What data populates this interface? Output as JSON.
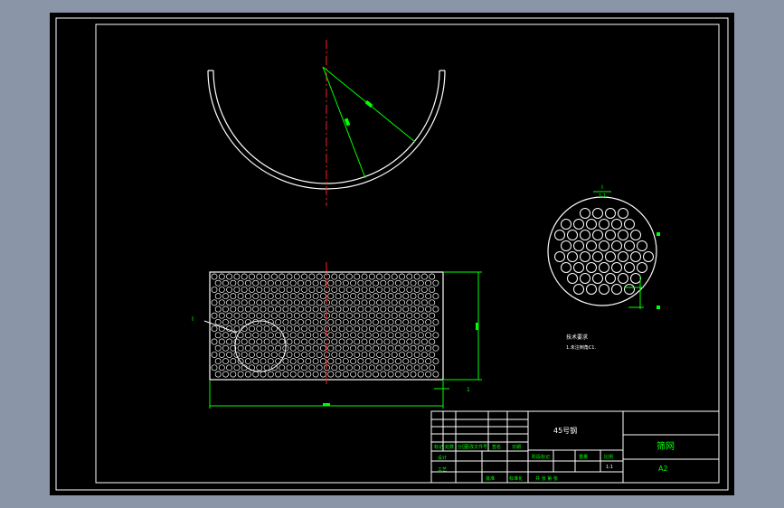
{
  "colors": {
    "app_background": "#8b95a8",
    "drawing_background": "#000000",
    "border_line": "#ffffff",
    "geometry_line": "#ffffff",
    "dimension_line": "#00ff00",
    "centerline": "#ff0000",
    "annotation_text": "#00ff00"
  },
  "drawing": {
    "material_label": "45号钢",
    "part_name": "筛网",
    "sheet_size": "A2",
    "scale_value": "1:1",
    "detail_label": "I",
    "detail_scale": "1:1",
    "detail_leader_label": "I",
    "dimension_right_label": "1",
    "tech_requirements_title": "技术要求",
    "tech_requirements_line": "1.未注倒角C1."
  },
  "title_block": {
    "row_labels": [
      "标记",
      "处数",
      "分区",
      "更改文件号",
      "签名",
      "日期"
    ],
    "design_label": "设计",
    "process_label": "工艺",
    "approve_label": "批准",
    "standard_label": "标准化",
    "stage_label": "阶段标记",
    "weight_label": "重量",
    "scale_label": "比例",
    "sheet_label": "共 张 第 张"
  }
}
